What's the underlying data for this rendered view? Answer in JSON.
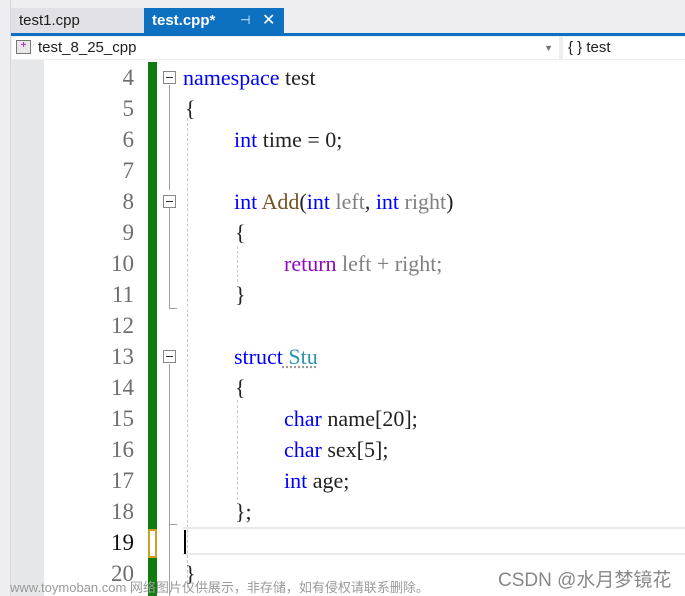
{
  "tabs": [
    {
      "label": "test1.cpp",
      "active": false
    },
    {
      "label": "test.cpp*",
      "active": true,
      "pin_icon": "⊣",
      "close_icon": "✕"
    }
  ],
  "navbar": {
    "project_dropdown": {
      "icon": "+",
      "label": "test_8_25_cpp",
      "arrow": "▼"
    },
    "scope_dropdown": {
      "label": "{ } test"
    }
  },
  "editor": {
    "current_line": 19,
    "lines": [
      {
        "n": "4"
      },
      {
        "n": "5"
      },
      {
        "n": "6"
      },
      {
        "n": "7"
      },
      {
        "n": "8"
      },
      {
        "n": "9"
      },
      {
        "n": "10"
      },
      {
        "n": "11"
      },
      {
        "n": "12"
      },
      {
        "n": "13"
      },
      {
        "n": "14"
      },
      {
        "n": "15"
      },
      {
        "n": "16"
      },
      {
        "n": "17"
      },
      {
        "n": "18"
      },
      {
        "n": "19"
      },
      {
        "n": "20"
      }
    ],
    "tokens": {
      "l4": {
        "kw": "namespace",
        "name": " test"
      },
      "l5": {
        "brace": "{"
      },
      "l6": {
        "kw": "int",
        "rest": " time = 0;"
      },
      "l8": {
        "kw": "int",
        "fn": " Add",
        "p1": "(",
        "kw2": "int",
        "a1": " left",
        "c": ", ",
        "kw3": "int",
        "a2": " right",
        "p2": ")"
      },
      "l9": {
        "brace": "{"
      },
      "l10": {
        "kw": "return",
        "rest": " left + right;"
      },
      "l11": {
        "brace": "}"
      },
      "l13": {
        "kw": "struct",
        "ty": " Stu"
      },
      "l14": {
        "brace": "{"
      },
      "l15": {
        "kw": "char",
        "rest": " name[20];"
      },
      "l16": {
        "kw": "char",
        "rest": " sex[5];"
      },
      "l17": {
        "kw": "int",
        "rest": " age;"
      },
      "l18": {
        "brace": "};"
      },
      "l20": {
        "brace": "}"
      }
    }
  },
  "watermarks": {
    "site": "www.toymoban.com 网络图片仅供展示，非存储，如有侵权请联系删除。",
    "author": "CSDN @水月梦镜花"
  }
}
